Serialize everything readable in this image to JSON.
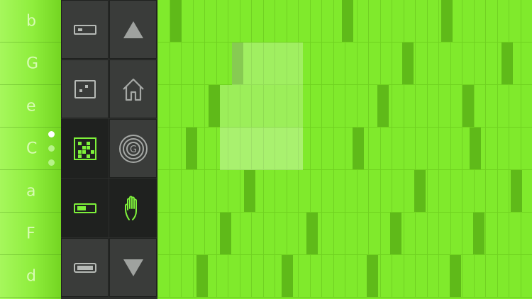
{
  "keys": [
    {
      "label": "b"
    },
    {
      "label": "G"
    },
    {
      "label": "e"
    },
    {
      "label": "C"
    },
    {
      "label": "a"
    },
    {
      "label": "F"
    },
    {
      "label": "d"
    }
  ],
  "page_dots": {
    "count": 3,
    "active": 0
  },
  "toolbar": {
    "left_tools": [
      {
        "name": "single-block-icon",
        "selected": false
      },
      {
        "name": "dot-block-icon",
        "selected": false
      },
      {
        "name": "pattern-grid-icon",
        "selected": true
      },
      {
        "name": "toggle-block-icon",
        "selected": true
      },
      {
        "name": "wide-block-icon",
        "selected": false
      }
    ],
    "right_tools": [
      {
        "name": "arrow-up-icon"
      },
      {
        "name": "home-icon"
      },
      {
        "name": "spiral-g-icon",
        "label": "G"
      },
      {
        "name": "hand-icon"
      },
      {
        "name": "arrow-down-icon"
      }
    ]
  },
  "colors": {
    "background_green": "#7fe52a",
    "accent_green": "#7ef23a",
    "toolbar_dark": "#2c2e2c"
  }
}
